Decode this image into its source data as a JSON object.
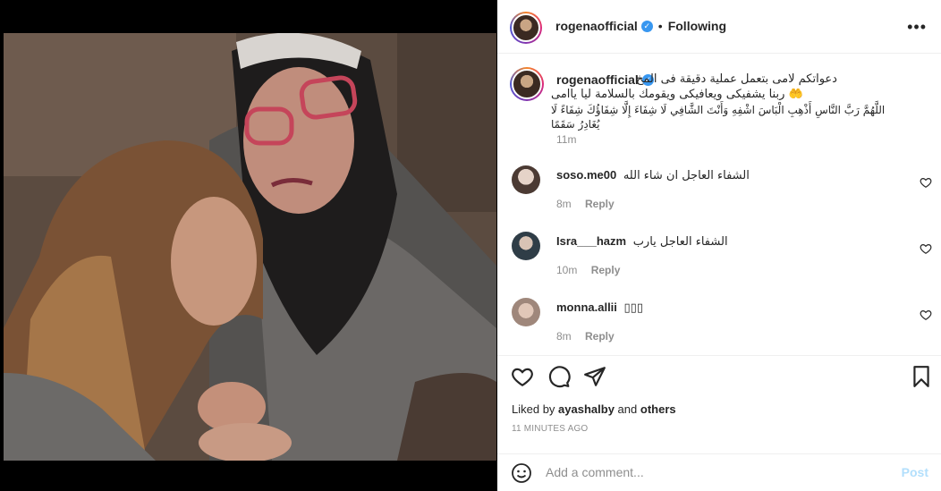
{
  "post": {
    "author": "rogenaofficial",
    "following_label": "Following",
    "more_label": "•••",
    "caption_lines": [
      "دعواتكم لامى بتعمل عملية دقيقة فى المخ",
      "🤲 ربنا يشفيكى ويعافيكى ويقومك بالسلامة ليا ياامى",
      "اللَّهُمَّ رَبَّ النَّاسِ أَذْهِبِ الْبَاسَ اشْفِهِ وَأَنْتَ الشَّافِي لَا شِفَاءَ إِلَّا شِفَاؤُكَ شِفَاءً لَا يُغَادِرُ سَقَمًا"
    ],
    "caption_time": "11m",
    "liked_by_prefix": "Liked by",
    "liked_by_user": "ayashalby",
    "liked_by_suffix": "and",
    "liked_by_others": "others",
    "time_ago": "11 MINUTES AGO"
  },
  "comments": [
    {
      "user": "soso.me00",
      "text": "الشفاء العاجل ان شاء الله",
      "time": "8m",
      "reply": "Reply",
      "avatar_color": "#c7b3a5"
    },
    {
      "user": "Isra___hazm",
      "text": "الشفاء العاجل يارب",
      "time": "10m",
      "reply": "Reply",
      "avatar_color": "#4a5d6b"
    },
    {
      "user": "monna.allii",
      "text": "▯▯▯",
      "time": "8m",
      "reply": "Reply",
      "avatar_color": "#b59c8f"
    }
  ],
  "add_comment": {
    "placeholder": "Add a comment...",
    "post_label": "Post"
  },
  "colors": {
    "verified": "#3897f0",
    "post_disabled": "#b2dffc",
    "muted": "#8e8e8e"
  },
  "icons": [
    "heart-icon",
    "comment-icon",
    "share-icon",
    "bookmark-icon",
    "emoji-icon",
    "verified-badge-icon",
    "more-options-icon"
  ]
}
